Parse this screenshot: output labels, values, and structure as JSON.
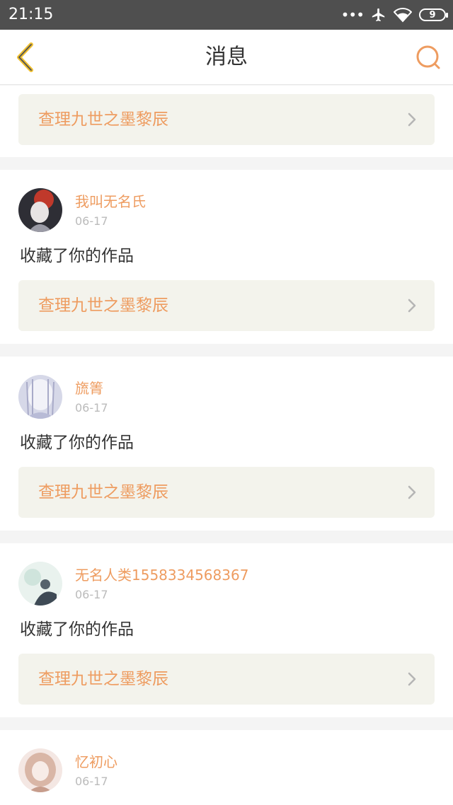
{
  "status_bar": {
    "time": "21:15",
    "dots": "•••",
    "battery_level": "9",
    "icons": [
      "more-dots-icon",
      "airplane-icon",
      "wifi-icon",
      "battery-icon"
    ]
  },
  "header": {
    "title": "消息",
    "back_icon": "chevron-left-icon",
    "search_icon": "search-icon"
  },
  "colors": {
    "accent": "#ee9c60",
    "back_arrow": "#f0c030",
    "link_bg": "#f3f3ec",
    "status_bar_bg": "#4f4f4f",
    "feed_bg": "#f4f4f4"
  },
  "first_card": {
    "work_title": "查理九世之墨黎辰"
  },
  "messages": [
    {
      "user": "我叫无名氏",
      "date": "06-17",
      "text": "收藏了你的作品",
      "work_title": "查理九世之墨黎辰"
    },
    {
      "user": "旒箐",
      "date": "06-17",
      "text": "收藏了你的作品",
      "work_title": "查理九世之墨黎辰"
    },
    {
      "user": "无名人类1558334568367",
      "date": "06-17",
      "text": "收藏了你的作品",
      "work_title": "查理九世之墨黎辰"
    },
    {
      "user": "忆初心",
      "date": "06-17"
    }
  ]
}
